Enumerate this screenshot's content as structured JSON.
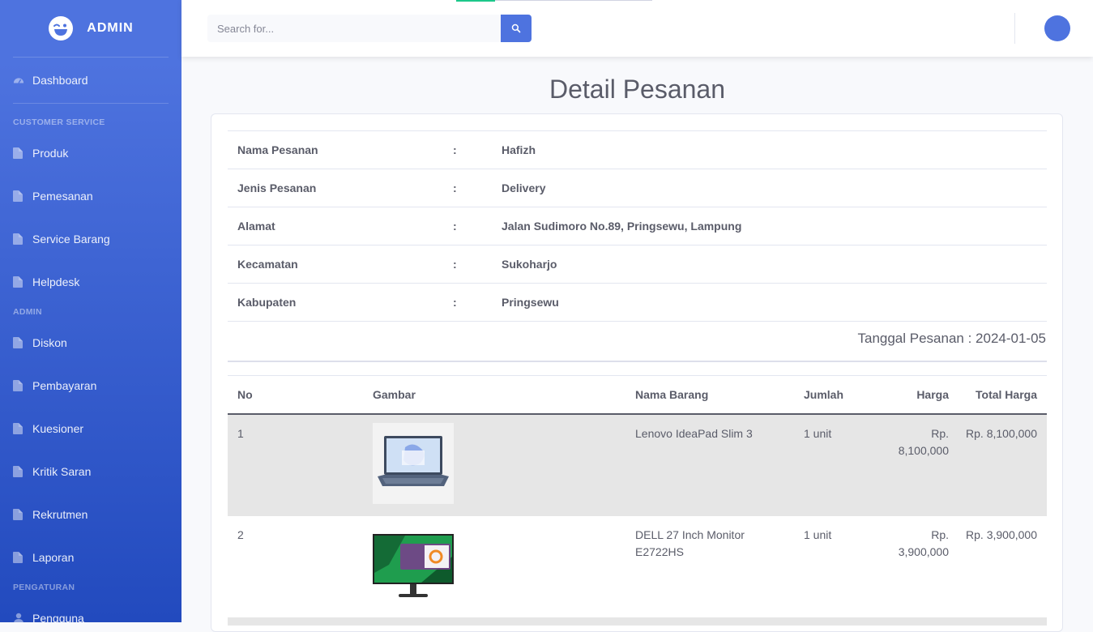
{
  "brand": {
    "name": "ADMIN",
    "icon": "laugh-wink-icon"
  },
  "sidebar": {
    "dashboard": "Dashboard",
    "sections": [
      {
        "heading": "CUSTOMER SERVICE",
        "items": [
          "Produk",
          "Pemesanan",
          "Service Barang",
          "Helpdesk"
        ]
      },
      {
        "heading": "ADMIN",
        "items": [
          "Diskon",
          "Pembayaran",
          "Kuesioner",
          "Kritik Saran",
          "Rekrutmen",
          "Laporan"
        ]
      },
      {
        "heading": "PENGATURAN",
        "items": [
          "Pengguna"
        ]
      }
    ]
  },
  "search": {
    "placeholder": "Search for...",
    "value": ""
  },
  "page": {
    "title": "Detail Pesanan"
  },
  "order_info": [
    {
      "label": "Nama Pesanan",
      "sep": ":",
      "value": "Hafizh"
    },
    {
      "label": "Jenis Pesanan",
      "sep": ":",
      "value": "Delivery"
    },
    {
      "label": "Alamat",
      "sep": ":",
      "value": "Jalan Sudimoro No.89, Pringsewu, Lampung"
    },
    {
      "label": "Kecamatan",
      "sep": ":",
      "value": "Sukoharjo"
    },
    {
      "label": "Kabupaten",
      "sep": ":",
      "value": "Pringsewu"
    }
  ],
  "tanggal": "Tanggal Pesanan : 2024-01-05",
  "table": {
    "headers": [
      "No",
      "Gambar",
      "Nama Barang",
      "Jumlah",
      "Harga",
      "Total Harga"
    ],
    "rows": [
      {
        "no": "1",
        "image": "laptop-image",
        "name": "Lenovo IdeaPad Slim 3",
        "qty": "1 unit",
        "price": "Rp. 8,100,000",
        "total": "Rp. 8,100,000"
      },
      {
        "no": "2",
        "image": "monitor-image",
        "name": "DELL 27 Inch Monitor E2722HS",
        "qty": "1 unit",
        "price": "Rp. 3,900,000",
        "total": "Rp. 3,900,000"
      }
    ]
  },
  "colors": {
    "primary": "#4e73df",
    "sidebar_end": "#224abe",
    "text": "#5a5c69",
    "stripe": "#e6e6e6"
  }
}
